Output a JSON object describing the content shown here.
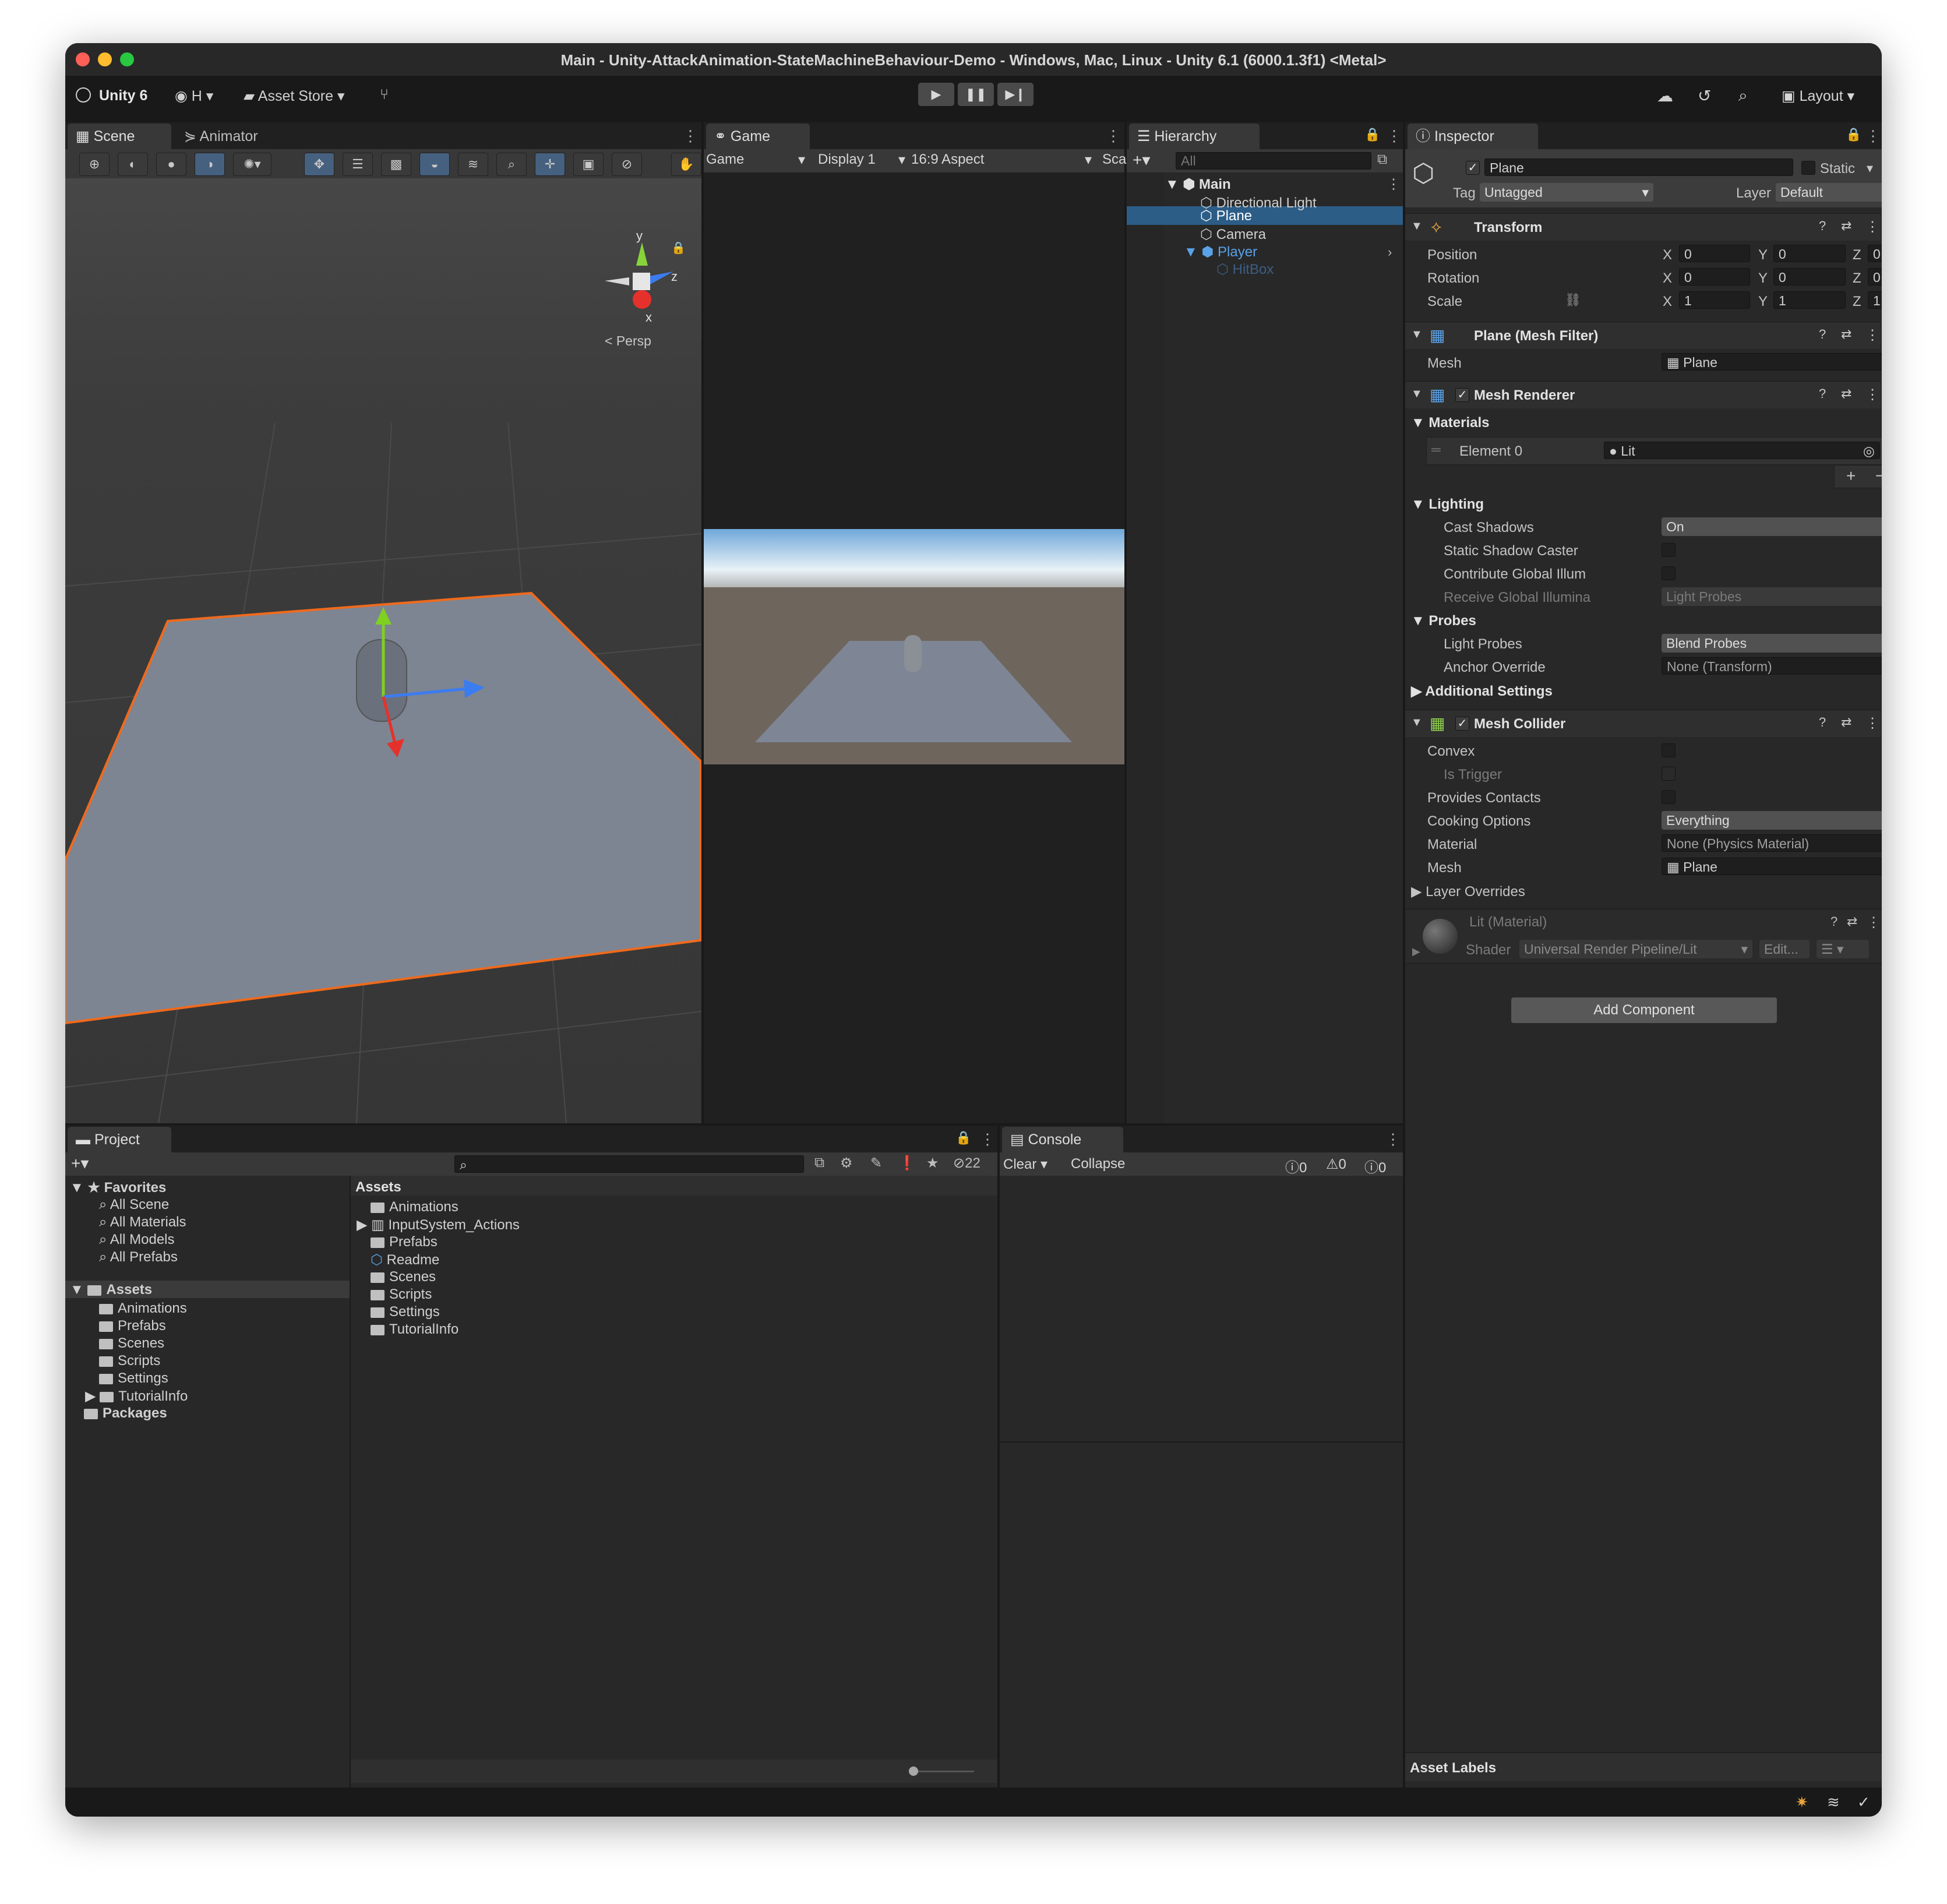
{
  "window": {
    "title": "Main - Unity-AttackAnimation-StateMachineBehaviour-Demo - Windows, Mac, Linux - Unity 6.1 (6000.1.3f1) <Metal>"
  },
  "toolbar": {
    "account": "Unity 6",
    "user": "H",
    "asset_store": "Asset Store",
    "layout": "Layout"
  },
  "scene": {
    "tabs": [
      "Scene",
      "Animator"
    ],
    "persp": "Persp",
    "gizmo_axes": {
      "y": "y",
      "z": "z",
      "x": "x"
    }
  },
  "game": {
    "tab": "Game",
    "mode": "Game",
    "display": "Display 1",
    "aspect": "16:9 Aspect",
    "scale": "Sca"
  },
  "hierarchy": {
    "tab": "Hierarchy",
    "search_placeholder": "All",
    "items": [
      {
        "label": "Main"
      },
      {
        "label": "Directional Light"
      },
      {
        "label": "Plane"
      },
      {
        "label": "Camera"
      },
      {
        "label": "Player"
      },
      {
        "label": "HitBox"
      }
    ]
  },
  "inspector": {
    "tab": "Inspector",
    "object_name": "Plane",
    "static_label": "Static",
    "tag_label": "Tag",
    "tag_value": "Untagged",
    "layer_label": "Layer",
    "layer_value": "Default",
    "transform": {
      "title": "Transform",
      "position_label": "Position",
      "rotation_label": "Rotation",
      "scale_label": "Scale",
      "axis": [
        "X",
        "Y",
        "Z"
      ],
      "position": [
        "0",
        "0",
        "0"
      ],
      "rotation": [
        "0",
        "0",
        "0"
      ],
      "scale": [
        "1",
        "1",
        "1"
      ]
    },
    "mesh_filter": {
      "title": "Plane (Mesh Filter)",
      "mesh_label": "Mesh",
      "mesh_value": "Plane"
    },
    "mesh_renderer": {
      "title": "Mesh Renderer",
      "materials_label": "Materials",
      "materials_count": "1",
      "element_label": "Element 0",
      "element_value": "Lit",
      "lighting_label": "Lighting",
      "cast_shadows_label": "Cast Shadows",
      "cast_shadows_value": "On",
      "static_shadow_label": "Static Shadow Caster",
      "contribute_gi_label": "Contribute Global Illum",
      "receive_gi_label": "Receive Global Illumina",
      "receive_gi_value": "Light Probes",
      "probes_label": "Probes",
      "light_probes_label": "Light Probes",
      "light_probes_value": "Blend Probes",
      "anchor_override_label": "Anchor Override",
      "anchor_override_value": "None (Transform)",
      "additional_settings_label": "Additional Settings"
    },
    "mesh_collider": {
      "title": "Mesh Collider",
      "convex_label": "Convex",
      "is_trigger_label": "Is Trigger",
      "provides_contacts_label": "Provides Contacts",
      "cooking_options_label": "Cooking Options",
      "cooking_options_value": "Everything",
      "material_label": "Material",
      "material_value": "None (Physics Material)",
      "mesh_label": "Mesh",
      "mesh_value": "Plane",
      "layer_overrides_label": "Layer Overrides"
    },
    "material": {
      "title": "Lit (Material)",
      "shader_label": "Shader",
      "shader_value": "Universal Render Pipeline/Lit",
      "edit_label": "Edit..."
    },
    "add_component": "Add Component",
    "asset_labels": "Asset Labels"
  },
  "project": {
    "tab": "Project",
    "hidden_count": "22",
    "favorites_label": "Favorites",
    "favorites": [
      "All Scene",
      "All Materials",
      "All Models",
      "All Prefabs"
    ],
    "assets_label": "Assets",
    "asset_tree": [
      "Animations",
      "Prefabs",
      "Scenes",
      "Scripts",
      "Settings",
      "TutorialInfo"
    ],
    "packages_label": "Packages",
    "breadcrumb": "Assets",
    "asset_list": [
      "Animations",
      "InputSystem_Actions",
      "Prefabs",
      "Readme",
      "Scenes",
      "Scripts",
      "Settings",
      "TutorialInfo"
    ]
  },
  "console": {
    "tab": "Console",
    "clear": "Clear",
    "collapse": "Collapse",
    "log_count": "0",
    "warn_count": "0",
    "error_count": "0"
  }
}
